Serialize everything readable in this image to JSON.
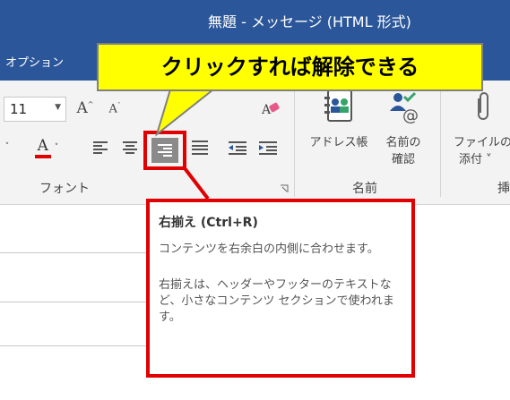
{
  "window": {
    "title": "無題 - メッセージ (HTML 形式)"
  },
  "tabs": {
    "options": "オプション"
  },
  "callout": {
    "text": "クリックすれば解除できる"
  },
  "ribbon": {
    "font_size": "11",
    "font_group_label": "フォント",
    "names_group_label": "名前",
    "address_book": "アドレス帳",
    "check_names_line1": "名前の",
    "check_names_line2": "確認",
    "attach_line1": "ファイルの",
    "attach_line2": "添付 ˅",
    "partial_label": "挿"
  },
  "tooltip": {
    "title": "右揃え (Ctrl+R)",
    "desc": "コンテンツを右余白の内側に合わせます。",
    "detail": "右揃えは、ヘッダーやフッターのテキストなど、小さなコンテンツ セクションで使われます。"
  },
  "colors": {
    "title_bar": "#2b579a",
    "highlight": "#e00000",
    "callout": "#ffff00"
  }
}
